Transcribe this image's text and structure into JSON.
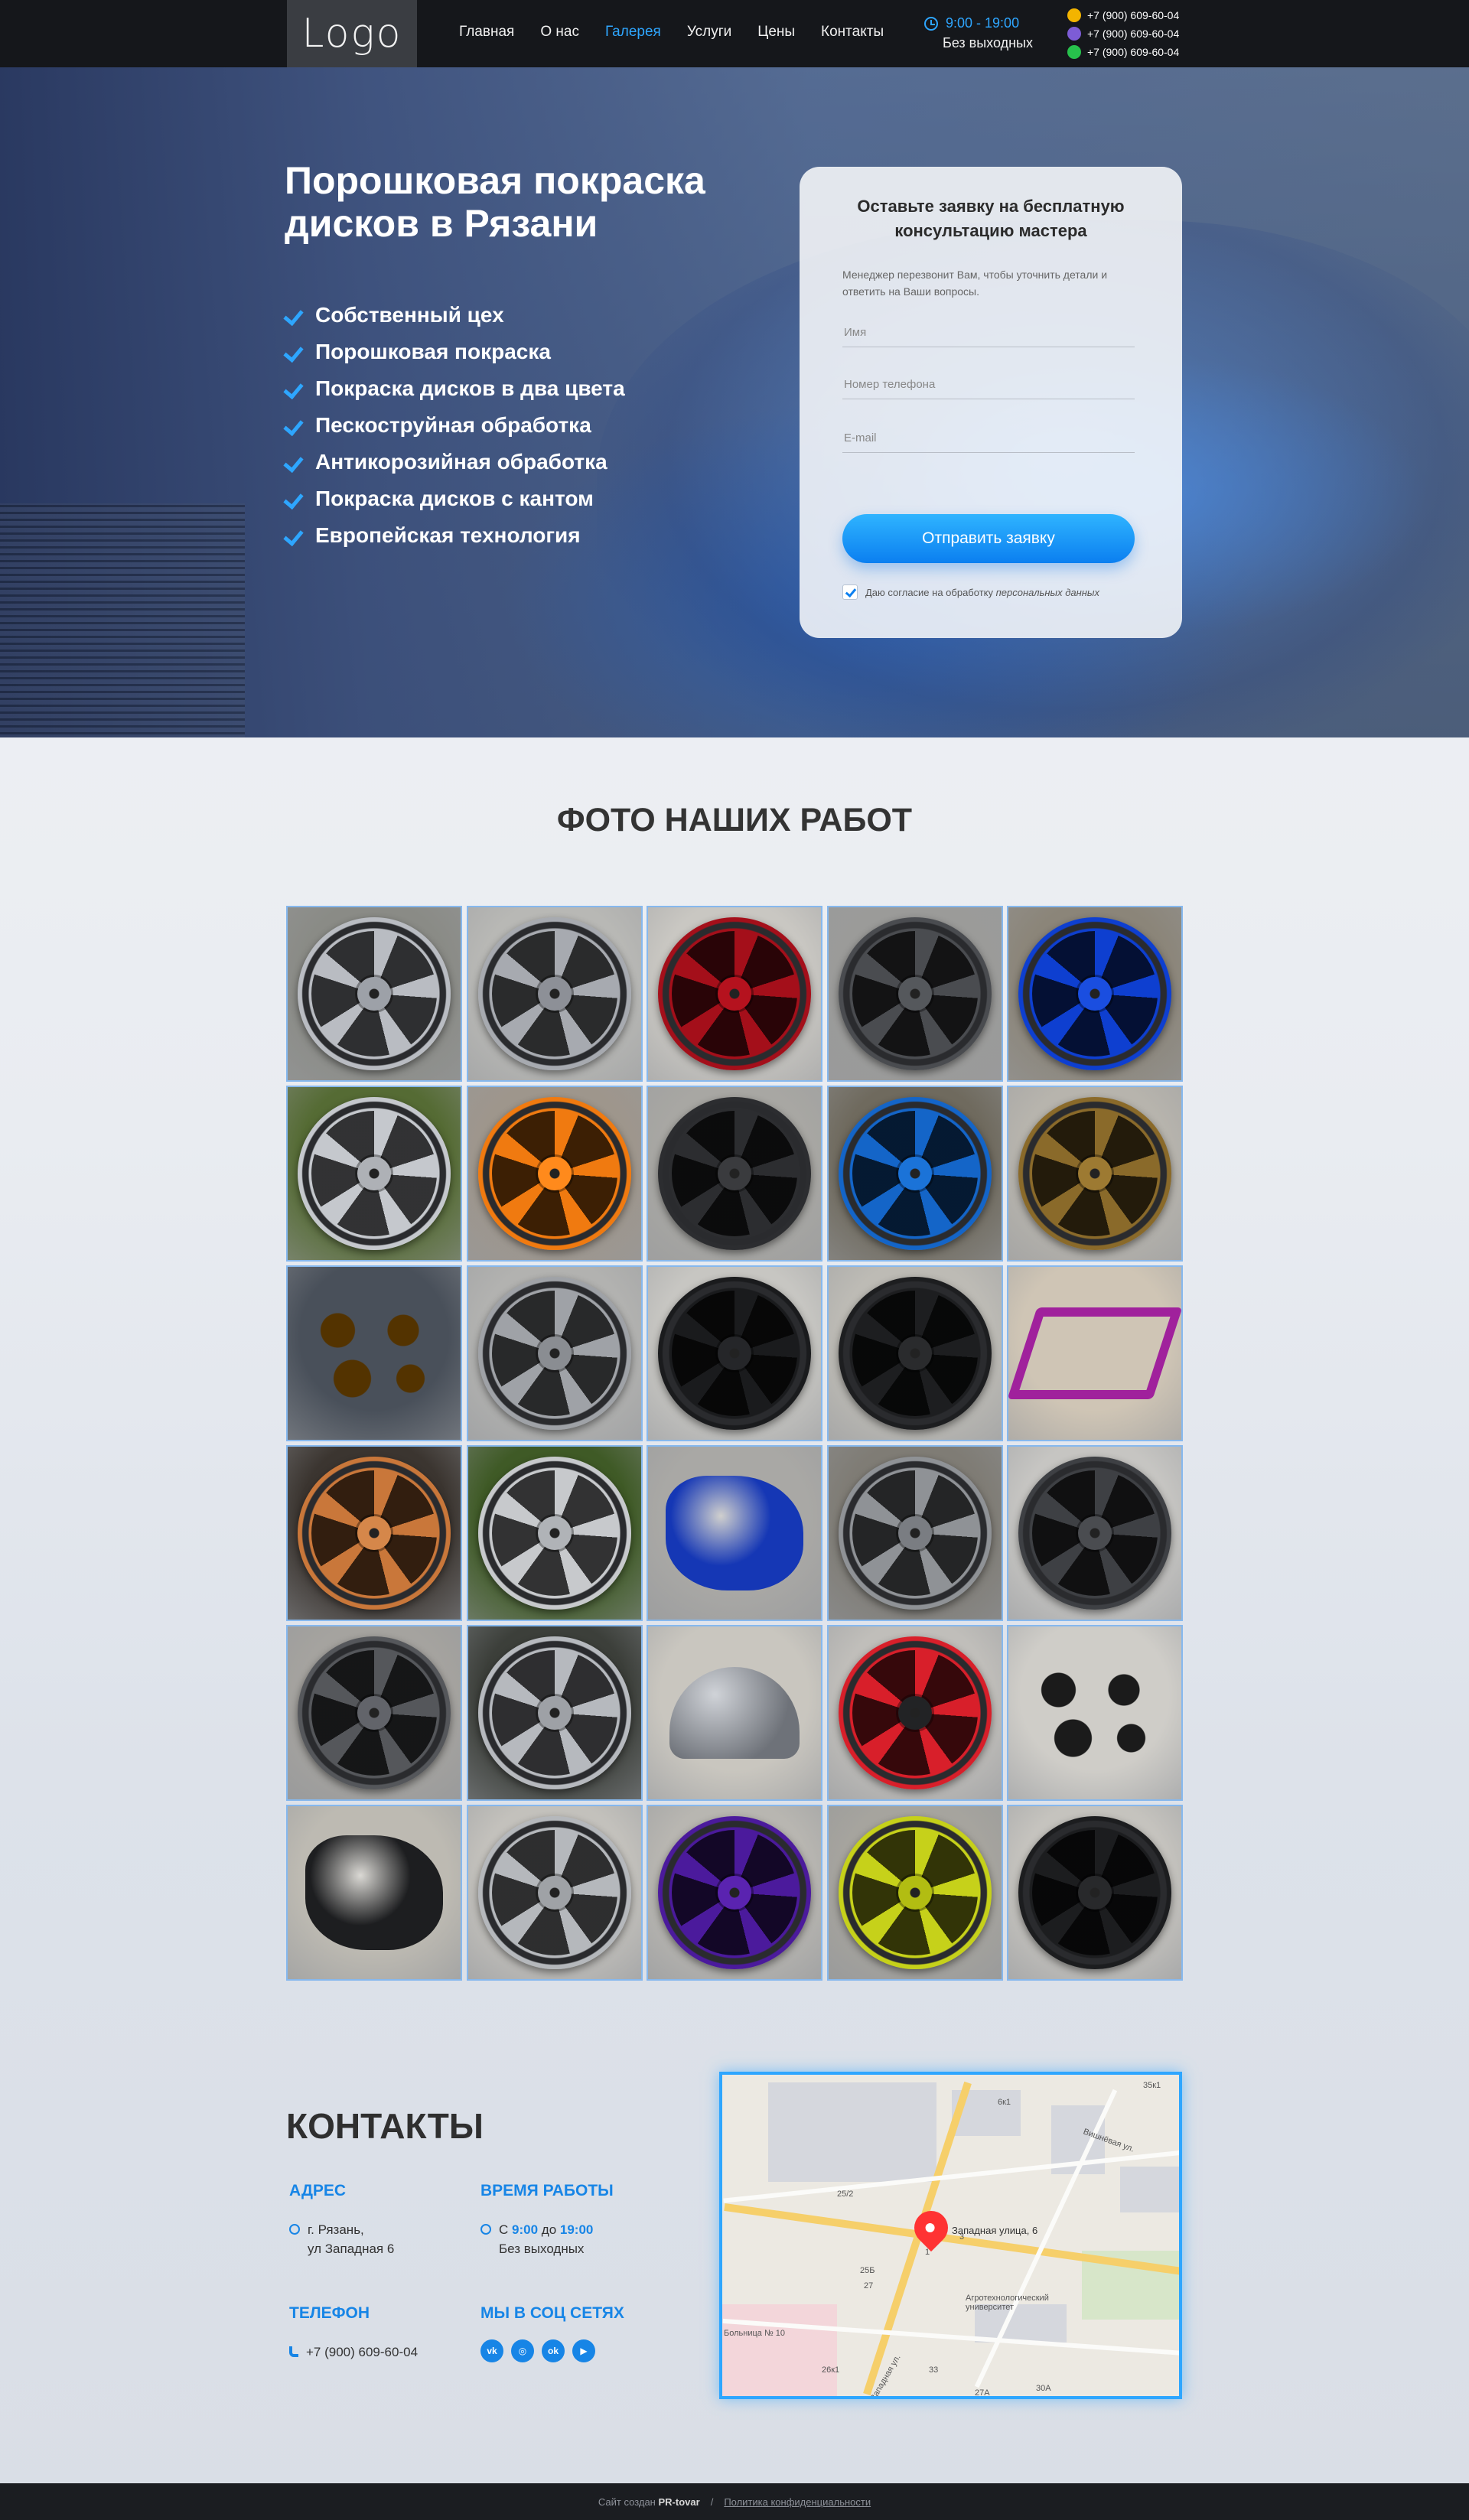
{
  "header": {
    "logo": "Logo",
    "nav": [
      {
        "label": "Главная",
        "active": false
      },
      {
        "label": "О нас",
        "active": false
      },
      {
        "label": "Галерея",
        "active": true
      },
      {
        "label": "Услуги",
        "active": false
      },
      {
        "label": "Цены",
        "active": false
      },
      {
        "label": "Контакты",
        "active": false
      }
    ],
    "hours": "9:00 - 19:00",
    "days": "Без выходных",
    "phones": [
      {
        "number": "+7 (900) 609-60-04",
        "icon": "viber-icon",
        "color": "#f3b400"
      },
      {
        "number": "+7 (900) 609-60-04",
        "icon": "viber-alt-icon",
        "color": "#7d5cd6"
      },
      {
        "number": "+7 (900) 609-60-04",
        "icon": "whatsapp-icon",
        "color": "#27c24c"
      }
    ]
  },
  "hero": {
    "title": "Порошковая покраска дисков в Рязани",
    "features": [
      "Собственный цех",
      "Порошковая покраска",
      "Покраска дисков в два цвета",
      "Пескоструйная обработка",
      "Антикорозийная обработка",
      "Покраска дисков с кантом",
      "Европейская технология"
    ]
  },
  "form": {
    "title": "Оставьте заявку на бесплатную консультацию мастера",
    "subtitle": "Менеджер перезвонит Вам, чтобы уточнить детали и ответить на Ваши вопросы.",
    "name_placeholder": "Имя",
    "phone_placeholder": "Номер телефона",
    "email_placeholder": "E-mail",
    "submit": "Отправить заявку",
    "consent_text": "Даю согласие на обработку",
    "consent_link": "персональных данных"
  },
  "gallery": {
    "title": "ФОТО НАШИХ РАБОТ",
    "photos": [
      {
        "kind": "wheel",
        "bg": "#8a8b86",
        "spoke": "#b9bcc2",
        "hub": "#9da1a8"
      },
      {
        "kind": "wheel",
        "bg": "#b8b8b5",
        "spoke": "#a7aab0",
        "hub": "#8d9097"
      },
      {
        "kind": "wheel",
        "bg": "#c9c7c2",
        "spoke": "#a40f1a",
        "hub": "#b5121e"
      },
      {
        "kind": "wheel",
        "bg": "#9b9b99",
        "spoke": "#4a4c50",
        "hub": "#55585c"
      },
      {
        "kind": "wheel",
        "bg": "#8b8579",
        "spoke": "#0e3fd0",
        "hub": "#1a4ee0"
      },
      {
        "kind": "wheel",
        "bg": "#556b34",
        "spoke": "#c5c8cd",
        "hub": "#aeb1b6"
      },
      {
        "kind": "wheel",
        "bg": "#9e968c",
        "spoke": "#f07a10",
        "hub": "#ff8a1c"
      },
      {
        "kind": "wheel",
        "bg": "#a8a7a3",
        "spoke": "#2c2d30",
        "hub": "#3a3b3e"
      },
      {
        "kind": "wheel",
        "bg": "#6f6a5e",
        "spoke": "#1465c8",
        "hub": "#1b73d8"
      },
      {
        "kind": "wheel",
        "bg": "#b7b4ad",
        "spoke": "#8a6a2a",
        "hub": "#9d7a32"
      },
      {
        "kind": "parts",
        "bg": "#49505a",
        "color": "#e6a415"
      },
      {
        "kind": "wheel",
        "bg": "#b2b2b0",
        "spoke": "#9fa2a7",
        "hub": "#8a8d92"
      },
      {
        "kind": "wheel",
        "bg": "#c7c6c2",
        "spoke": "#1a1b1d",
        "hub": "#252629"
      },
      {
        "kind": "wheel",
        "bg": "#bdbbb5",
        "spoke": "#1d1e20",
        "hub": "#2a2b2d"
      },
      {
        "kind": "frame",
        "bg": "#cfc5b5",
        "color": "#a0219c"
      },
      {
        "kind": "wheel",
        "bg": "#3b3530",
        "spoke": "#c9773a",
        "hub": "#d5874a"
      },
      {
        "kind": "wheel",
        "bg": "#3f5a26",
        "spoke": "#c7c9cc",
        "hub": "#b0b3b7"
      },
      {
        "kind": "blob",
        "bg": "#a9a8a5",
        "color": "#1537b5"
      },
      {
        "kind": "wheel",
        "bg": "#7f7c75",
        "spoke": "#8f9296",
        "hub": "#7a7d82"
      },
      {
        "kind": "wheel",
        "bg": "#c6c5c2",
        "spoke": "#3e4044",
        "hub": "#4a4c50"
      },
      {
        "kind": "wheel",
        "bg": "#a5a39f",
        "spoke": "#55575b",
        "hub": "#62646a"
      },
      {
        "kind": "wheel",
        "bg": "#3c3f3a",
        "spoke": "#b6b9be",
        "hub": "#9ea1a6"
      },
      {
        "kind": "helmet",
        "bg": "#c9c6bf",
        "color": "#8a8d92"
      },
      {
        "kind": "wheel",
        "bg": "#c0beba",
        "spoke": "#d81f2a",
        "hub": "#222325"
      },
      {
        "kind": "parts",
        "bg": "#cfcdc8",
        "color": "#1b1b1b"
      },
      {
        "kind": "blob",
        "bg": "#bdbab2",
        "color": "#1d1e20"
      },
      {
        "kind": "wheel",
        "bg": "#c3c1bc",
        "spoke": "#b5b8bc",
        "hub": "#9fa2a6"
      },
      {
        "kind": "wheel",
        "bg": "#b8b6b1",
        "spoke": "#4b1a9c",
        "hub": "#5a23b0"
      },
      {
        "kind": "wheel",
        "bg": "#a6a49e",
        "spoke": "#c6d11a",
        "hub": "#b2bd12"
      },
      {
        "kind": "wheel",
        "bg": "#c5c3be",
        "spoke": "#1c1d1f",
        "hub": "#28292b"
      }
    ]
  },
  "contacts": {
    "title": "КОНТАКТЫ",
    "address_label": "АДРЕС",
    "address_line1": "г. Рязань,",
    "address_line2": "ул Западная 6",
    "hours_label": "ВРЕМЯ РАБОТЫ",
    "hours_prefix": "С",
    "hours_from": "9:00",
    "hours_mid": "до",
    "hours_to": "19:00",
    "hours_days": "Без выходных",
    "phone_label": "ТЕЛЕФОН",
    "phone": "+7 (900) 609-60-04",
    "social_label": "МЫ В СОЦ СЕТЯХ",
    "socials": [
      {
        "name": "vk-icon",
        "glyph": "vk"
      },
      {
        "name": "instagram-icon",
        "glyph": "◎"
      },
      {
        "name": "odnoklassniki-icon",
        "glyph": "ok"
      },
      {
        "name": "youtube-icon",
        "glyph": "▶"
      }
    ]
  },
  "map": {
    "pin_label": "Западная улица, 6",
    "university_label": "Агротехнологический университет",
    "hospital_label": "Больница № 10",
    "street_label_1": "Западная ул.",
    "street_label_2": "Вишнёвая ул.",
    "numbers": [
      "25Б",
      "6к1",
      "25/2",
      "27",
      "1",
      "33",
      "26к1",
      "30А",
      "27А",
      "35к1",
      "3"
    ]
  },
  "footer": {
    "created_by": "Сайт создан",
    "agency": "PR-tovar",
    "separator": "/",
    "policy": "Политика конфиденциальности"
  }
}
